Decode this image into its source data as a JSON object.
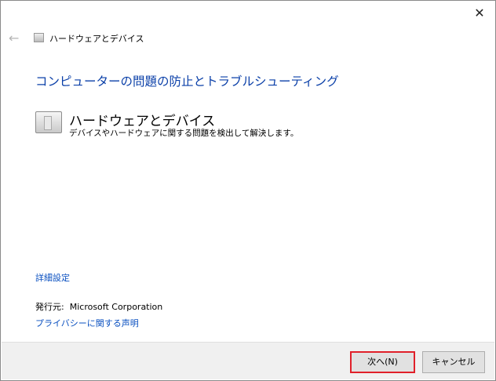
{
  "window": {
    "close_icon": "close-icon"
  },
  "nav": {
    "back_icon": "back-arrow-icon",
    "title": "ハードウェアとデバイス"
  },
  "main": {
    "heading": "コンピューターの問題の防止とトラブルシューティング",
    "item_title": "ハードウェアとデバイス",
    "item_description": "デバイスやハードウェアに関する問題を検出して解決します。",
    "advanced_link": "詳細設定",
    "publisher_label": "発行元:",
    "publisher": "Microsoft Corporation",
    "privacy_link": "プライバシーに関する声明"
  },
  "footer": {
    "next_label": "次へ(N)",
    "cancel_label": "キャンセル"
  }
}
